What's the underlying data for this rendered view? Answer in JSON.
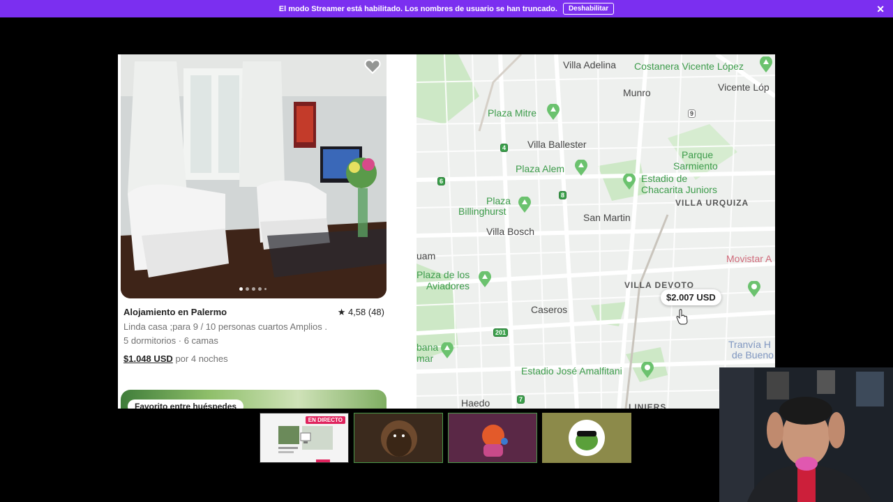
{
  "banner": {
    "message": "El modo Streamer está habilitado. Los nombres de usuario se han truncado.",
    "button": "Deshabilitar"
  },
  "listing": {
    "title": "Alojamiento en Palermo",
    "rating": "★ 4,58 (48)",
    "description": "Linda casa ;para 9 / 10 personas cuartos Amplios .",
    "beds": "5 dormitorios · 6 camas",
    "price": "$1.048 USD",
    "price_suffix": "por 4 noches"
  },
  "next_listing": {
    "badge": "Favorito entre huéspedes"
  },
  "map": {
    "price_pin": "$2.007 USD",
    "labels": {
      "villa_adelina": "Villa Adelina",
      "costanera": "Costanera Vicente López",
      "munro": "Munro",
      "vicente_lopez": "Vicente Lóp",
      "plaza_mitre": "Plaza Mitre",
      "villa_ballester": "Villa Ballester",
      "parque_sarmiento_1": "Parque",
      "parque_sarmiento_2": "Sarmiento",
      "plaza_alem": "Plaza Alem",
      "estadio_chacarita_1": "Estadio de",
      "estadio_chacarita_2": "Chacarita Juniors",
      "plaza_billinghurst_1": "Plaza",
      "plaza_billinghurst_2": "Billinghurst",
      "villa_urquiza": "VILLA URQUIZA",
      "san_martin": "San Martin",
      "villa_bosch": "Villa Bosch",
      "uam": "uam",
      "plaza_aviadores_1": "Plaza de los",
      "plaza_aviadores_2": "Aviadores",
      "movistar": "Movistar A",
      "villa_devoto": "VILLA DEVOTO",
      "caseros": "Caseros",
      "tranvia_1": "Tranvía H",
      "tranvia_2": "de Bueno",
      "bana_1": "bana",
      "bana_2": "mar",
      "estadio_amalfitani": "Estadio José Amalfitani",
      "haedo": "Haedo",
      "liniers": "LINIERS",
      "route_9": "9",
      "route_4": "4",
      "route_6": "6",
      "route_8": "8",
      "route_201": "201",
      "route_7": "7"
    }
  },
  "thumbnails": {
    "live_badge": "EN DIRECTO"
  },
  "colors": {
    "banner": "#7b2ff0",
    "park_green": "#3c9b4a",
    "live": "#e0245e"
  }
}
